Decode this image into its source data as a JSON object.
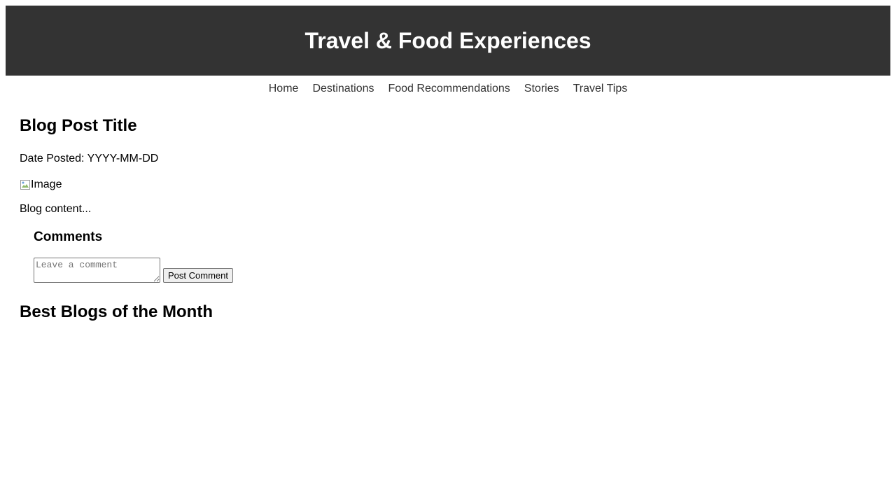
{
  "header": {
    "title": "Travel & Food Experiences"
  },
  "nav": {
    "items": [
      {
        "label": "Home"
      },
      {
        "label": "Destinations"
      },
      {
        "label": "Food Recommendations"
      },
      {
        "label": "Stories"
      },
      {
        "label": "Travel Tips"
      }
    ]
  },
  "post": {
    "title": "Blog Post Title",
    "date": "Date Posted: YYYY-MM-DD",
    "image_alt": "Image",
    "content": "Blog content..."
  },
  "comments": {
    "heading": "Comments",
    "placeholder": "Leave a comment",
    "submit_label": "Post Comment"
  },
  "best_blogs": {
    "heading": "Best Blogs of the Month"
  },
  "colors": {
    "header_bg": "#333333",
    "header_text": "#ffffff",
    "nav_link": "#333333"
  }
}
